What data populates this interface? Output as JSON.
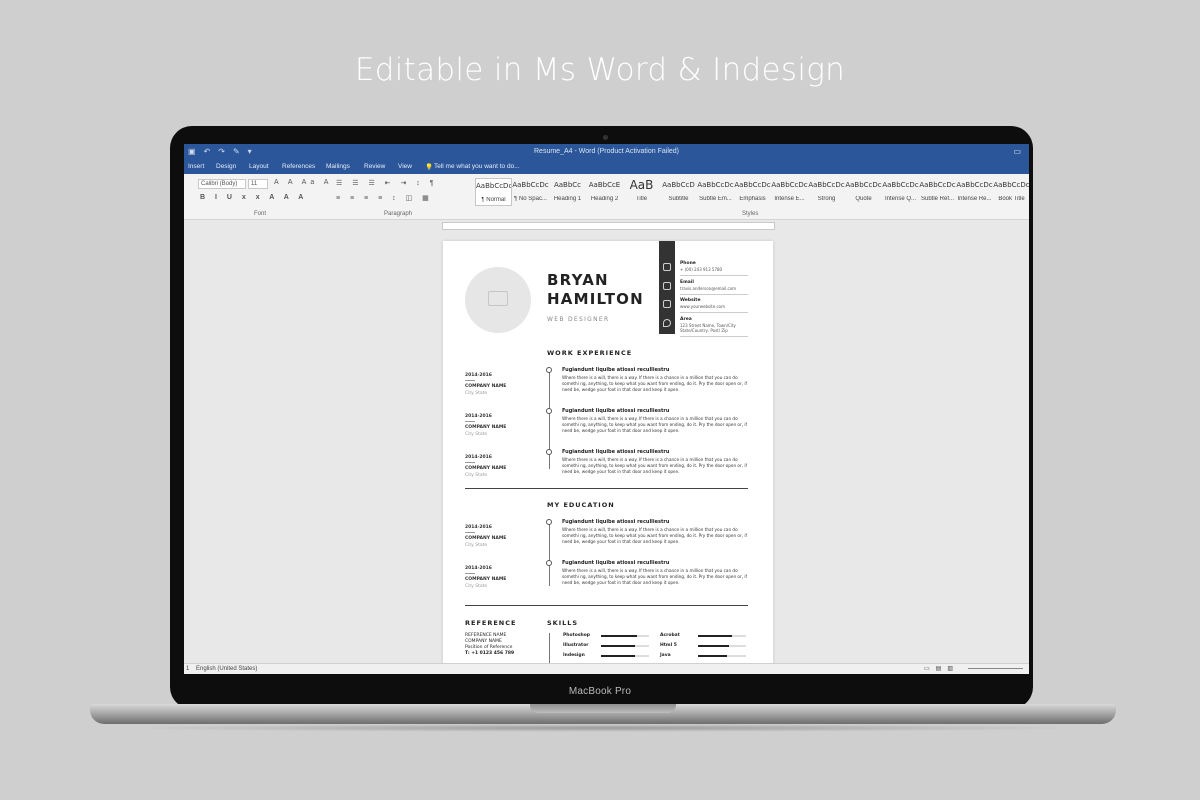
{
  "headline": "Editable in Ms Word & Indesign",
  "laptop_label": "MacBook Pro",
  "word": {
    "window_title": "Resume_A4 - Word (Product Activation Failed)",
    "tabs": [
      "Insert",
      "Design",
      "Layout",
      "References",
      "Mailings",
      "Review",
      "View"
    ],
    "tell_me": "Tell me what you want to do...",
    "font_name": "Calibri (Body)",
    "font_size": "11",
    "group_labels": {
      "font": "Font",
      "paragraph": "Paragraph",
      "styles": "Styles"
    },
    "styles": [
      {
        "sample": "AaBbCcDc",
        "name": "¶ Normal"
      },
      {
        "sample": "AaBbCcDc",
        "name": "¶ No Spac..."
      },
      {
        "sample": "AaBbCc",
        "name": "Heading 1"
      },
      {
        "sample": "AaBbCcE",
        "name": "Heading 2"
      },
      {
        "sample": "AaB",
        "name": "Title"
      },
      {
        "sample": "AaBbCcD",
        "name": "Subtitle"
      },
      {
        "sample": "AaBbCcDc",
        "name": "Subtle Em..."
      },
      {
        "sample": "AaBbCcDc",
        "name": "Emphasis"
      },
      {
        "sample": "AaBbCcDc",
        "name": "Intense E..."
      },
      {
        "sample": "AaBbCcDc",
        "name": "Strong"
      },
      {
        "sample": "AaBbCcDc",
        "name": "Quote"
      },
      {
        "sample": "AaBbCcDc",
        "name": "Intense Q..."
      },
      {
        "sample": "AaBbCcDc",
        "name": "Subtle Ref..."
      },
      {
        "sample": "AaBbCcDc",
        "name": "Intense Re..."
      },
      {
        "sample": "AaBbCcDc",
        "name": "Book Title"
      }
    ],
    "status_language": "English (United States)"
  },
  "resume": {
    "first_name": "BRYAN",
    "last_name": "HAMILTON",
    "job_title": "WEB DESIGNER",
    "contacts": [
      {
        "label": "Phone",
        "value": "+ (00) 243 913 5780"
      },
      {
        "label": "Email",
        "value": "travis.anderson@email.com"
      },
      {
        "label": "Website",
        "value": "www.yourwebsite.com"
      },
      {
        "label": "Area",
        "value": "123 Street Name, Town/City State/Country, Post/ Zip"
      }
    ],
    "work_title": "WORK EXPERIENCE",
    "education_title": "MY EDUCATION",
    "reference_title": "REFERENCE",
    "skills_title": "SKILLS",
    "work": [
      {
        "date": "2014-2016",
        "company": "COMPANY NAME",
        "location": "City State",
        "title": "Fugiandunt liquibe atiossi reculliestru",
        "desc": "Where there is a will, there is a way. If there is a chance in a million that you can do somethi ng, anything, to keep what you want from ending, do it. Pry the door open or, if need be, wedge your foot in that door and keep it open."
      },
      {
        "date": "2014-2016",
        "company": "COMPANY NAME",
        "location": "City State",
        "title": "Fugiandunt liquibe atiossi reculliestru",
        "desc": "Where there is a will, there is a way. If there is a chance in a million that you can do somethi ng, anything, to keep what you want from ending, do it. Pry the door open or, if need be, wedge your foot in that door and keep it open."
      },
      {
        "date": "2014-2016",
        "company": "COMPANY NAME",
        "location": "City State",
        "title": "Fugiandunt liquibe atiossi reculliestru",
        "desc": "Where there is a will, there is a way. If there is a chance in a million that you can do somethi ng, anything, to keep what you want from ending, do it. Pry the door open or, if need be, wedge your foot in that door and keep it open."
      }
    ],
    "education": [
      {
        "date": "2014-2016",
        "company": "COMPANY NAME",
        "location": "City State",
        "title": "Fugiandunt liquibe atiossi reculliestru",
        "desc": "Where there is a will, there is a way. If there is a chance in a million that you can do somethi ng, anything, to keep what you want from ending, do it. Pry the door open or, if need be, wedge your foot in that door and keep it open."
      },
      {
        "date": "2014-2016",
        "company": "COMPANY NAME",
        "location": "City State",
        "title": "Fugiandunt liquibe atiossi reculliestru",
        "desc": "Where there is a will, there is a way. If there is a chance in a million that you can do somethi ng, anything, to keep what you want from ending, do it. Pry the door open or, if need be, wedge your foot in that door and keep it open."
      }
    ],
    "reference": {
      "name": "REFERENCE NAME",
      "company": "COMPANY NAME",
      "position": "Position of Reference",
      "phone": "T: +1 0123 456 789"
    },
    "skills": [
      {
        "name": "Photoshop",
        "level": 0.75
      },
      {
        "name": "Acrobat",
        "level": 0.7
      },
      {
        "name": "Illustrator",
        "level": 0.7
      },
      {
        "name": "Html 5",
        "level": 0.65
      },
      {
        "name": "Indesign",
        "level": 0.7
      },
      {
        "name": "Java",
        "level": 0.6
      }
    ]
  }
}
